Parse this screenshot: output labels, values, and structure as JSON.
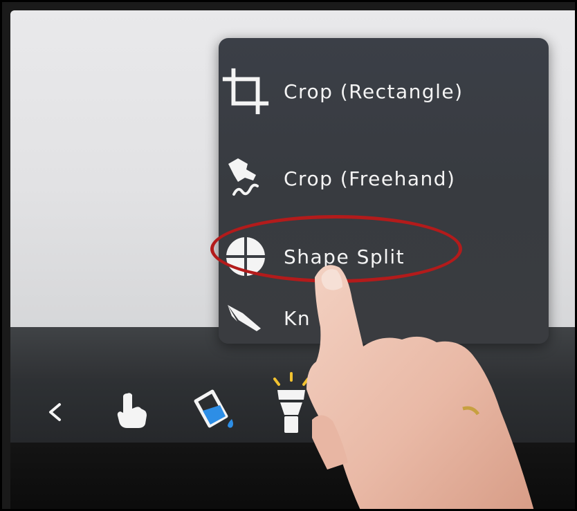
{
  "menu": {
    "items": [
      {
        "label": "Crop (Rectangle)",
        "icon": "crop-rectangle-icon"
      },
      {
        "label": "Crop (Freehand)",
        "icon": "crop-freehand-icon"
      },
      {
        "label": "Shape Split",
        "icon": "shape-split-icon"
      },
      {
        "label": "Kn",
        "icon": "knife-icon"
      }
    ]
  },
  "toolbar": {
    "tools": [
      "back-chevron-icon",
      "hand-pointer-icon",
      "paint-bucket-icon",
      "flashlight-icon"
    ]
  },
  "colors": {
    "menu_bg": "#3a3d43",
    "highlight": "#b31b1b",
    "fill_blue": "#2d8ee6",
    "flash_yellow": "#f2c230"
  }
}
